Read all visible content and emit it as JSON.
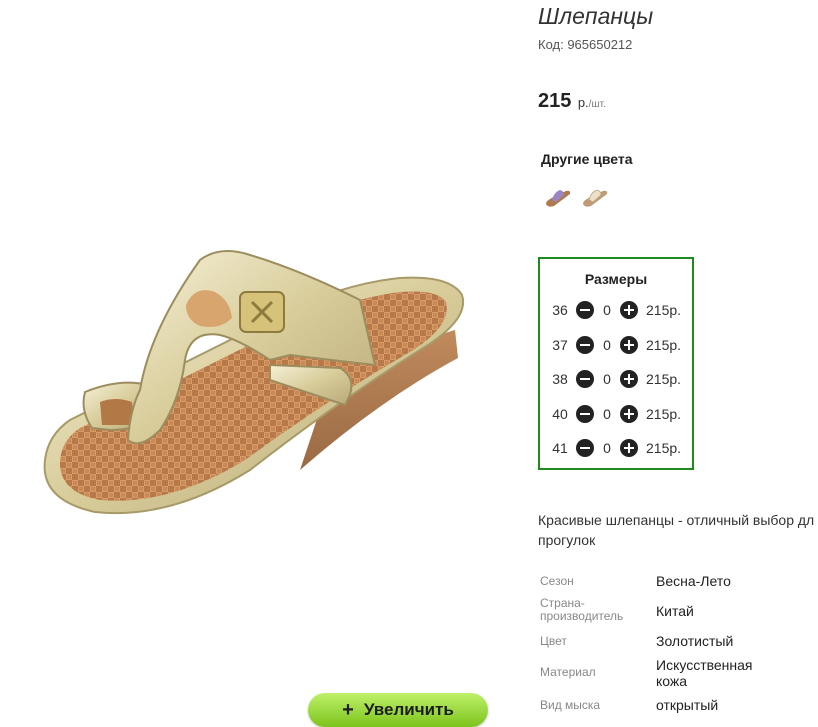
{
  "product": {
    "title": "Шлепанцы",
    "code": "Код: 965650212",
    "price_value": "215",
    "price_unit": "р.",
    "price_per": "/шт."
  },
  "zoom_button": {
    "label": "Увеличить",
    "icon": "plus-icon"
  },
  "colors": {
    "heading": "Другие цвета",
    "swatches": [
      {
        "name": "lilac-sandal",
        "color": "#9b86c4"
      },
      {
        "name": "beige-sandal",
        "color": "#d9c4a4"
      }
    ]
  },
  "sizes": {
    "title": "Размеры",
    "rows": [
      {
        "size": "36",
        "qty": "0",
        "price": "215р."
      },
      {
        "size": "37",
        "qty": "0",
        "price": "215р."
      },
      {
        "size": "38",
        "qty": "0",
        "price": "215р."
      },
      {
        "size": "40",
        "qty": "0",
        "price": "215р."
      },
      {
        "size": "41",
        "qty": "0",
        "price": "215р."
      }
    ]
  },
  "description": {
    "line1": "Красивые шлепанцы - отличный выбор дл",
    "line2": "прогулок"
  },
  "attributes": [
    {
      "name": "Сезон",
      "value": "Весна-Лето"
    },
    {
      "name": "Страна-производитель",
      "value": "Китай"
    },
    {
      "name": "Цвет",
      "value": "Золотистый"
    },
    {
      "name": "Материал",
      "value": "Искусственная кожа"
    },
    {
      "name": "Вид мыска",
      "value": "открытый"
    }
  ],
  "theme": {
    "accent_green": "#1f8a1f",
    "button_green": "#8fd22a"
  }
}
